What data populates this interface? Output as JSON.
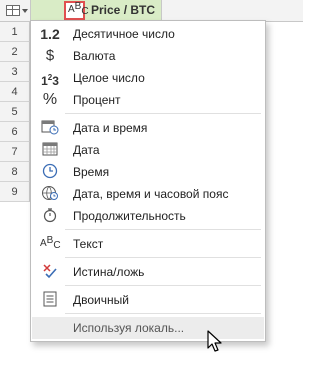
{
  "column_header": {
    "title": "Price / BTC",
    "type_icon": "abc-text-type-icon"
  },
  "row_numbers": [
    "1",
    "2",
    "3",
    "4",
    "5",
    "6",
    "7",
    "8",
    "9"
  ],
  "menu": {
    "items": [
      {
        "label": "Десятичное число",
        "icon": "1.2",
        "icon_name": "decimal-number-icon"
      },
      {
        "label": "Валюта",
        "icon": "$",
        "icon_name": "currency-icon"
      },
      {
        "label": "Целое число",
        "icon": "1²3",
        "icon_name": "whole-number-icon"
      },
      {
        "label": "Процент",
        "icon": "%",
        "icon_name": "percent-icon"
      },
      {
        "label": "Дата и время",
        "icon_name": "datetime-icon"
      },
      {
        "label": "Дата",
        "icon_name": "date-icon"
      },
      {
        "label": "Время",
        "icon_name": "time-icon"
      },
      {
        "label": "Дата, время и часовой пояс",
        "icon_name": "datetimezone-icon"
      },
      {
        "label": "Продолжительность",
        "icon_name": "duration-icon"
      },
      {
        "label": "Текст",
        "icon": "ABC",
        "icon_name": "text-type-icon"
      },
      {
        "label": "Истина/ложь",
        "icon_name": "true-false-icon"
      },
      {
        "label": "Двоичный",
        "icon_name": "binary-icon"
      },
      {
        "label": "Используя локаль...",
        "icon_name": "",
        "hover": true
      }
    ]
  }
}
